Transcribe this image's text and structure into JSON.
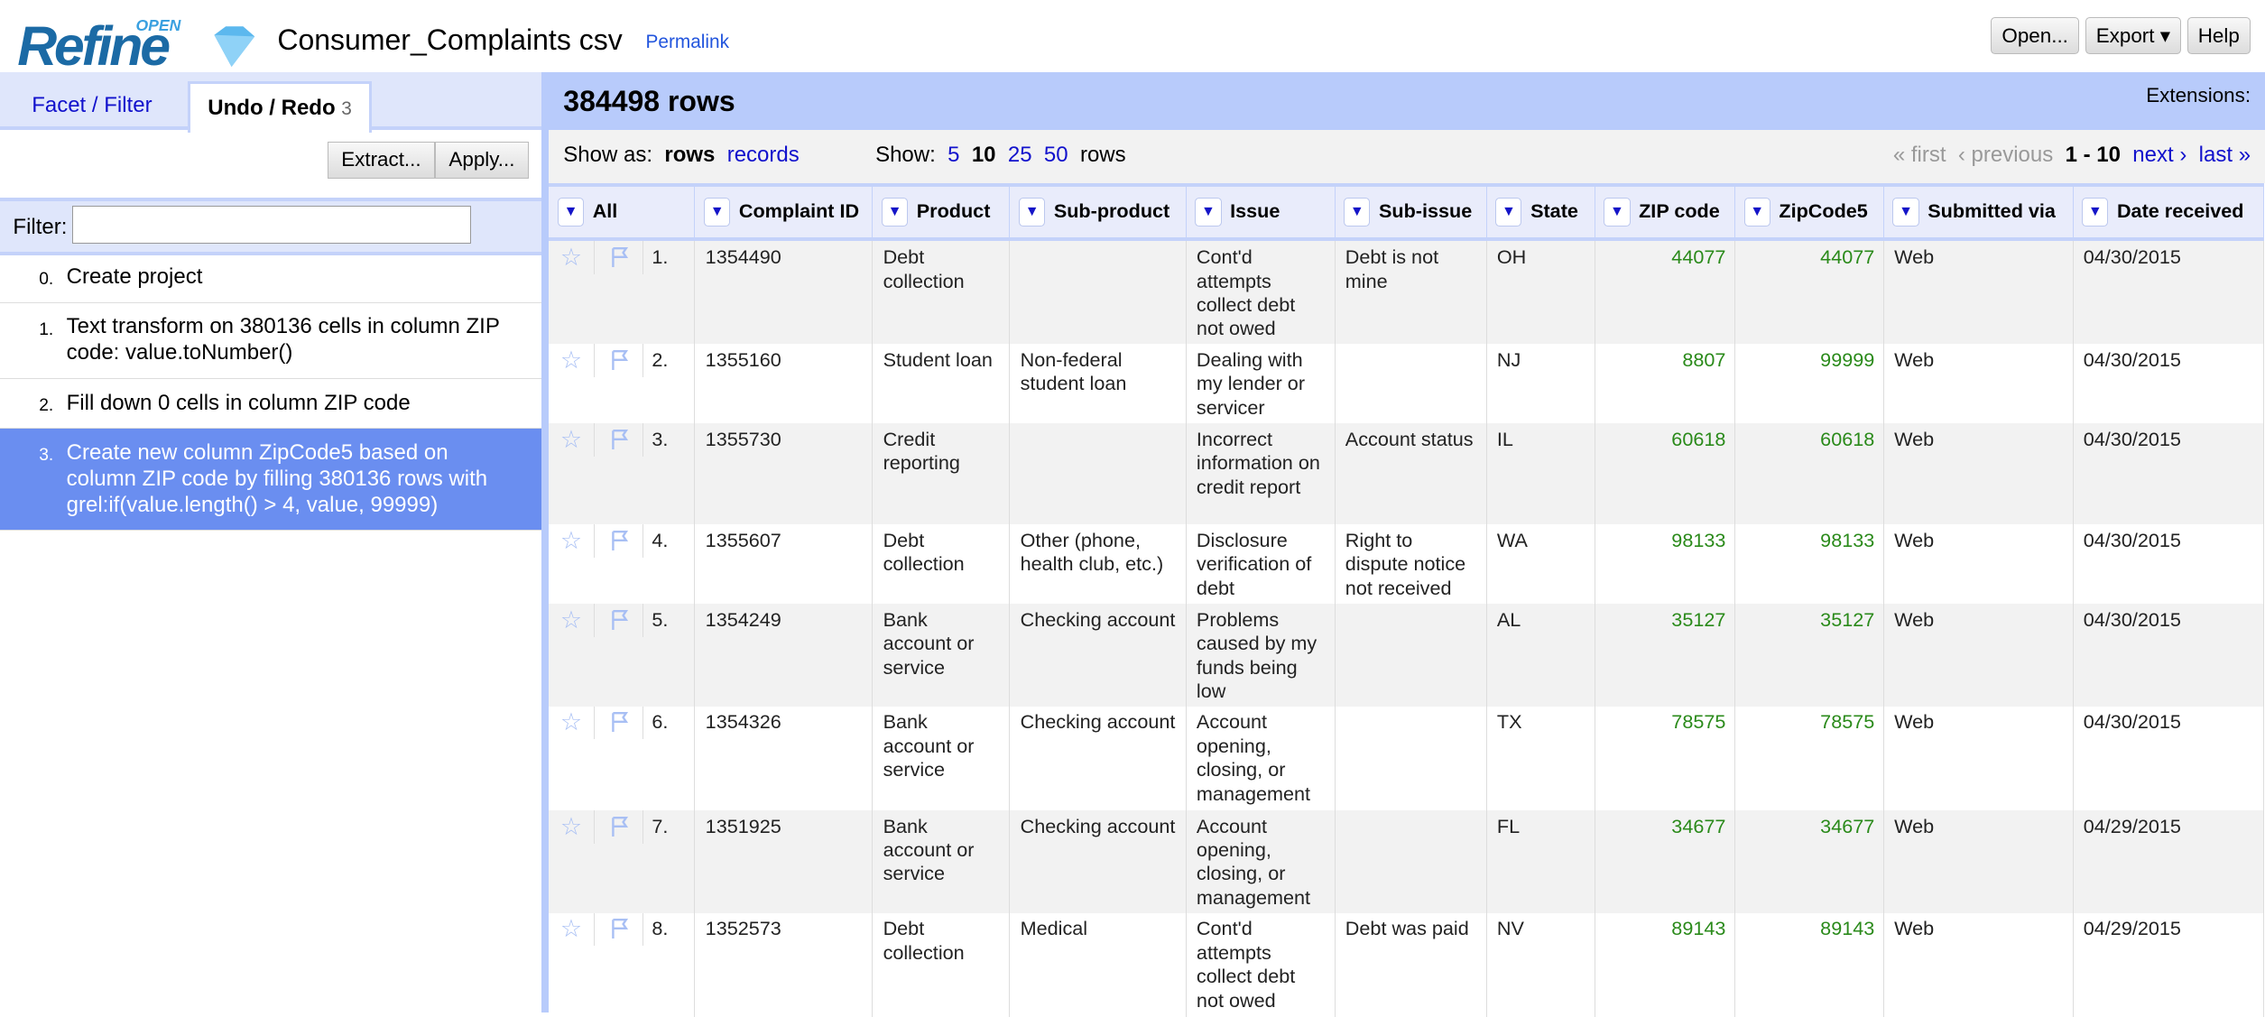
{
  "app": {
    "logo_main": "Refine",
    "logo_open": "OPEN",
    "project_title": "Consumer_Complaints csv",
    "permalink": "Permalink"
  },
  "top_buttons": {
    "open": "Open...",
    "export": "Export ▾",
    "help": "Help"
  },
  "left_panel": {
    "tabs": [
      {
        "label": "Facet / Filter"
      },
      {
        "label": "Undo / Redo",
        "count": "3"
      }
    ],
    "extract": "Extract...",
    "apply": "Apply...",
    "filter_label": "Filter:",
    "filter_value": "",
    "history": [
      {
        "num": "0.",
        "text": "Create project"
      },
      {
        "num": "1.",
        "text": "Text transform on 380136 cells in column ZIP code: value.toNumber()"
      },
      {
        "num": "2.",
        "text": "Fill down 0 cells in column ZIP code"
      },
      {
        "num": "3.",
        "text": "Create new column ZipCode5 based on column ZIP code by filling 380136 rows with grel:if(value.length() > 4, value, 99999)",
        "selected": true
      }
    ]
  },
  "grid": {
    "row_count": "384498 rows",
    "extensions": "Extensions:",
    "show_as_label": "Show as:",
    "show_as_rows": "rows",
    "show_as_records": "records",
    "show_label": "Show:",
    "show_5": "5",
    "show_10": "10",
    "show_25": "25",
    "show_50": "50",
    "show_unit": "rows",
    "first": "« first",
    "previous": "‹ previous",
    "range": "1 - 10",
    "next": "next ›",
    "last": "last »",
    "columns": [
      "All",
      "Complaint ID",
      "Product",
      "Sub-product",
      "Issue",
      "Sub-issue",
      "State",
      "ZIP code",
      "ZipCode5",
      "Submitted via",
      "Date received"
    ],
    "rows": [
      [
        "1.",
        "1354490",
        "Debt collection",
        "",
        "Cont'd attempts collect debt not owed",
        "Debt is not mine",
        "OH",
        "44077",
        "44077",
        "Web",
        "04/30/2015"
      ],
      [
        "2.",
        "1355160",
        "Student loan",
        "Non-federal student loan",
        "Dealing with my lender or servicer",
        "",
        "NJ",
        "8807",
        "99999",
        "Web",
        "04/30/2015"
      ],
      [
        "3.",
        "1355730",
        "Credit reporting",
        "",
        "Incorrect information on credit report",
        "Account status",
        "IL",
        "60618",
        "60618",
        "Web",
        "04/30/2015"
      ],
      [
        "4.",
        "1355607",
        "Debt collection",
        "Other (phone, health club, etc.)",
        "Disclosure verification of debt",
        "Right to dispute notice not received",
        "WA",
        "98133",
        "98133",
        "Web",
        "04/30/2015"
      ],
      [
        "5.",
        "1354249",
        "Bank account or service",
        "Checking account",
        "Problems caused by my funds being low",
        "",
        "AL",
        "35127",
        "35127",
        "Web",
        "04/30/2015"
      ],
      [
        "6.",
        "1354326",
        "Bank account or service",
        "Checking account",
        "Account opening, closing, or management",
        "",
        "TX",
        "78575",
        "78575",
        "Web",
        "04/30/2015"
      ],
      [
        "7.",
        "1351925",
        "Bank account or service",
        "Checking account",
        "Account opening, closing, or management",
        "",
        "FL",
        "34677",
        "34677",
        "Web",
        "04/29/2015"
      ],
      [
        "8.",
        "1352573",
        "Debt collection",
        "Medical",
        "Cont'd attempts collect debt not owed",
        "Debt was paid",
        "NV",
        "89143",
        "89143",
        "Web",
        "04/29/2015"
      ]
    ]
  }
}
